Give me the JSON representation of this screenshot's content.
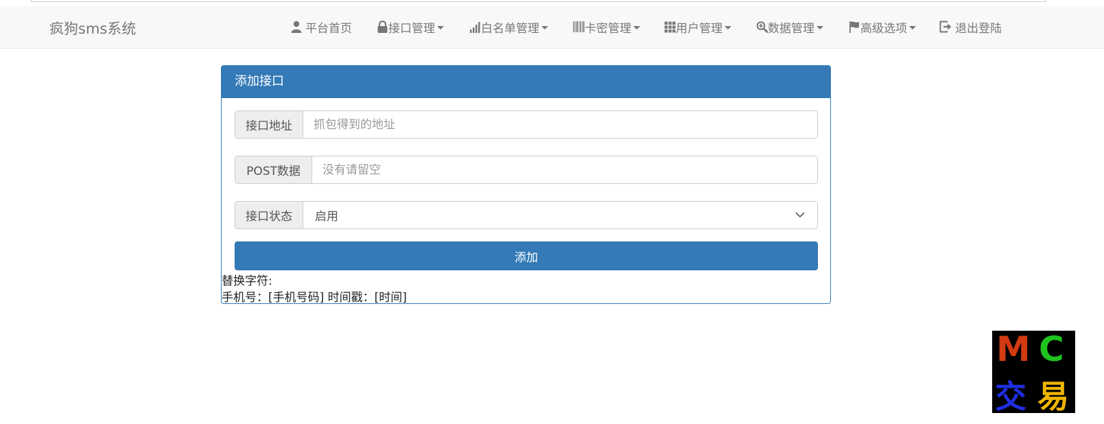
{
  "app": {
    "brand": "疯狗sms系统"
  },
  "nav": {
    "items": [
      {
        "label": "平台首页",
        "icon": "user-icon",
        "dropdown": false
      },
      {
        "label": "接口管理",
        "icon": "lock-icon",
        "dropdown": true
      },
      {
        "label": "白名单管理",
        "icon": "signal-icon",
        "dropdown": true
      },
      {
        "label": "卡密管理",
        "icon": "barcode-icon",
        "dropdown": true
      },
      {
        "label": "用户管理",
        "icon": "grid-icon",
        "dropdown": true
      },
      {
        "label": "数据管理",
        "icon": "zoom-in-icon",
        "dropdown": true
      },
      {
        "label": "高级选项",
        "icon": "flag-icon",
        "dropdown": true
      },
      {
        "label": "退出登陆",
        "icon": "log-out-icon",
        "dropdown": false
      }
    ]
  },
  "panel": {
    "title": "添加接口",
    "url": {
      "label": "接口地址",
      "value": "",
      "placeholder": "抓包得到的地址"
    },
    "post": {
      "label": "POST数据",
      "value": "",
      "placeholder": "没有请留空"
    },
    "status": {
      "label": "接口状态",
      "selected": "启用"
    },
    "submit_label": "添加",
    "note_title": "替换字符:",
    "note_line": "手机号：[手机号码] 时间戳：[时间]"
  },
  "watermark": {
    "letters": [
      "M",
      "C",
      "交",
      "易"
    ]
  },
  "colors": {
    "primary": "#337ab7",
    "navbar_bg": "#f8f8f8",
    "nav_text": "#777777"
  }
}
